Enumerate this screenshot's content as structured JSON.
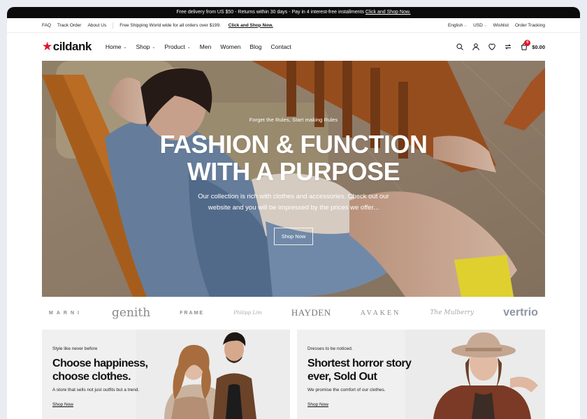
{
  "announcement": {
    "text": "Free delivery from US $50 - Returns within 30 days - Pay in 4 interest-free installments",
    "link": "Click and Shop Now."
  },
  "utility": {
    "links": [
      "FAQ",
      "Track Order",
      "About Us"
    ],
    "promo_text": "Free Shipping World wide for all orders over $199.",
    "promo_link": "Click and Shop Now.",
    "language": "English",
    "currency": "USD",
    "wishlist": "Wishlist",
    "order_tracking": "Order Tracking"
  },
  "header": {
    "logo": "cildank",
    "nav": [
      {
        "label": "Home"
      },
      {
        "label": "Shop"
      },
      {
        "label": "Product"
      },
      {
        "label": "Men"
      },
      {
        "label": "Women"
      },
      {
        "label": "Blog"
      },
      {
        "label": "Contact"
      }
    ],
    "cart_count": "0",
    "cart_total": "$0.00"
  },
  "hero": {
    "kicker": "Forget the Rules, Start making Rules",
    "title_line1": "FASHION & FUNCTION",
    "title_line2": "WITH A PURPOSE",
    "description": "Our collection is rich with clothes and accessories. Check out our website and you will be impressed by the prices we offer...",
    "button": "Shop Now"
  },
  "brands": [
    "MARNI",
    "genith",
    "FRAME",
    "Philipp Lim",
    "HAYDEN",
    "AVAKEN",
    "The Mulberry",
    "vertrio"
  ],
  "cards": [
    {
      "kicker": "Style like never before",
      "title": "Choose happiness, choose clothes.",
      "description": "A store that sells not just outfits but a trend.",
      "link": "Shop Now"
    },
    {
      "kicker": "Dresses to be noticed.",
      "title": "Shortest horror story ever, Sold Out",
      "description": "We promise the comfort of our clothes.",
      "link": "Shop Now"
    }
  ],
  "colors": {
    "accent": "#e0122b",
    "announcement_bg": "#0b0b0b"
  }
}
